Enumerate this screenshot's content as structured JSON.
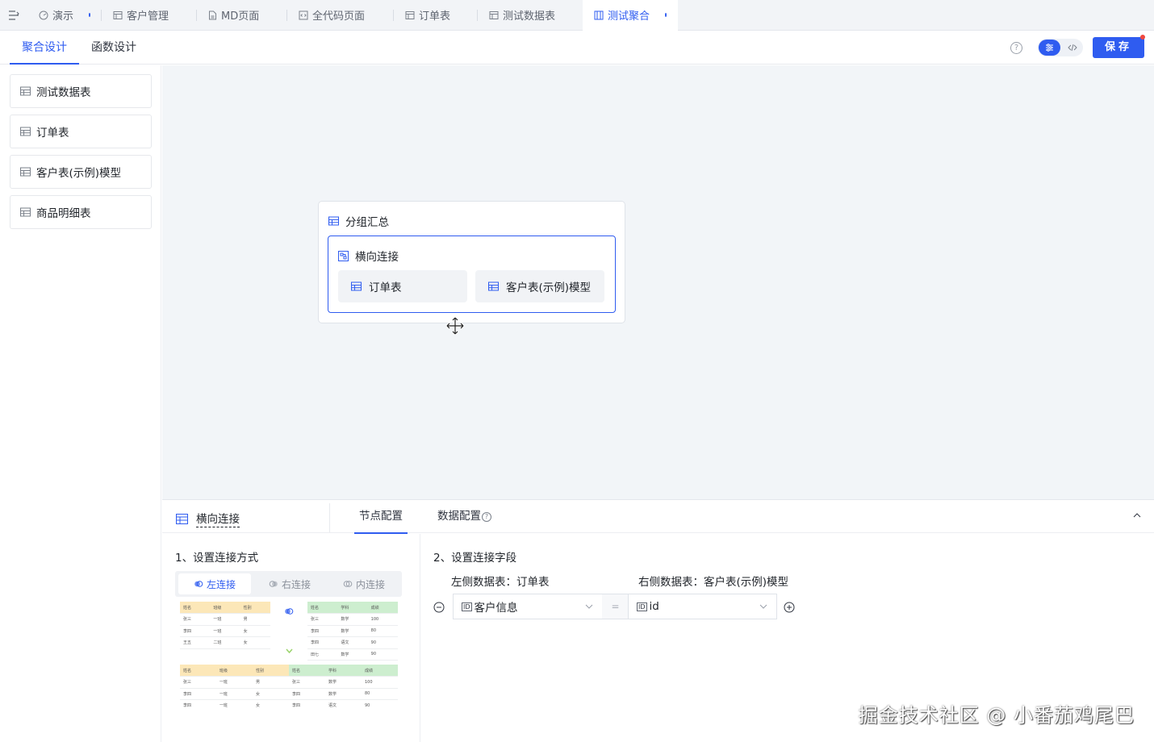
{
  "tabs": [
    {
      "label": "演示",
      "icon": "dashboard-icon",
      "dot": true,
      "active": false
    },
    {
      "label": "客户管理",
      "icon": "table-icon",
      "dot": false,
      "active": false
    },
    {
      "label": "MD页面",
      "icon": "file-icon",
      "dot": false,
      "active": false
    },
    {
      "label": "全代码页面",
      "icon": "code-icon",
      "dot": false,
      "active": false
    },
    {
      "label": "订单表",
      "icon": "table-icon",
      "dot": false,
      "active": false
    },
    {
      "label": "测试数据表",
      "icon": "table-icon",
      "dot": false,
      "active": false
    },
    {
      "label": "测试聚合",
      "icon": "aggregate-icon",
      "dot": true,
      "active": true
    }
  ],
  "subnav": {
    "tabs": [
      {
        "label": "聚合设计",
        "active": true
      },
      {
        "label": "函数设计",
        "active": false
      }
    ],
    "help": "?",
    "save_label": "保存"
  },
  "sidebar": {
    "items": [
      {
        "label": "测试数据表"
      },
      {
        "label": "订单表"
      },
      {
        "label": "客户表(示例)模型"
      },
      {
        "label": "商品明细表"
      }
    ]
  },
  "canvas": {
    "group_title": "分组汇总",
    "join_title": "横向连接",
    "tables": [
      "订单表",
      "客户表(示例)模型"
    ]
  },
  "panel": {
    "node_name": "横向连接",
    "tabs": [
      {
        "label": "节点配置",
        "active": true
      },
      {
        "label": "数据配置",
        "active": false
      }
    ],
    "section1_title": "1、设置连接方式",
    "join_types": [
      {
        "label": "左连接",
        "active": true
      },
      {
        "label": "右连接",
        "active": false
      },
      {
        "label": "内连接",
        "active": false
      }
    ],
    "section2_title": "2、设置连接字段",
    "left_table_label": "左侧数据表：订单表",
    "right_table_label": "右侧数据表：客户表(示例)模型",
    "left_field": "客户信息",
    "right_field": "id",
    "field_type_tag": "ID",
    "equals": "=",
    "illustration": {
      "left_headers": [
        "姓名",
        "班级",
        "性别"
      ],
      "left_rows": [
        [
          "张三",
          "一班",
          "男"
        ],
        [
          "李四",
          "一班",
          "女"
        ],
        [
          "王五",
          "二班",
          "女"
        ]
      ],
      "right_headers": [
        "姓名",
        "学科",
        "成绩"
      ],
      "right_rows": [
        [
          "张三",
          "数学",
          "100"
        ],
        [
          "李四",
          "数学",
          "80"
        ],
        [
          "李四",
          "语文",
          "90"
        ],
        [
          "田七",
          "数学",
          "90"
        ]
      ],
      "result_headers": [
        "姓名",
        "班级",
        "性别",
        "姓名",
        "学科",
        "成绩"
      ],
      "result_rows": [
        [
          "张三",
          "一班",
          "男",
          "张三",
          "数学",
          "100"
        ],
        [
          "李四",
          "一班",
          "女",
          "李四",
          "数学",
          "80"
        ],
        [
          "李四",
          "一班",
          "女",
          "李四",
          "语文",
          "90"
        ]
      ]
    }
  },
  "watermark": "掘金技术社区 @ 小番茄鸡尾巴",
  "colors": {
    "accent": "#2f5cf0",
    "canvas_bg": "#f2f5f8",
    "badge": "#f0483e"
  }
}
